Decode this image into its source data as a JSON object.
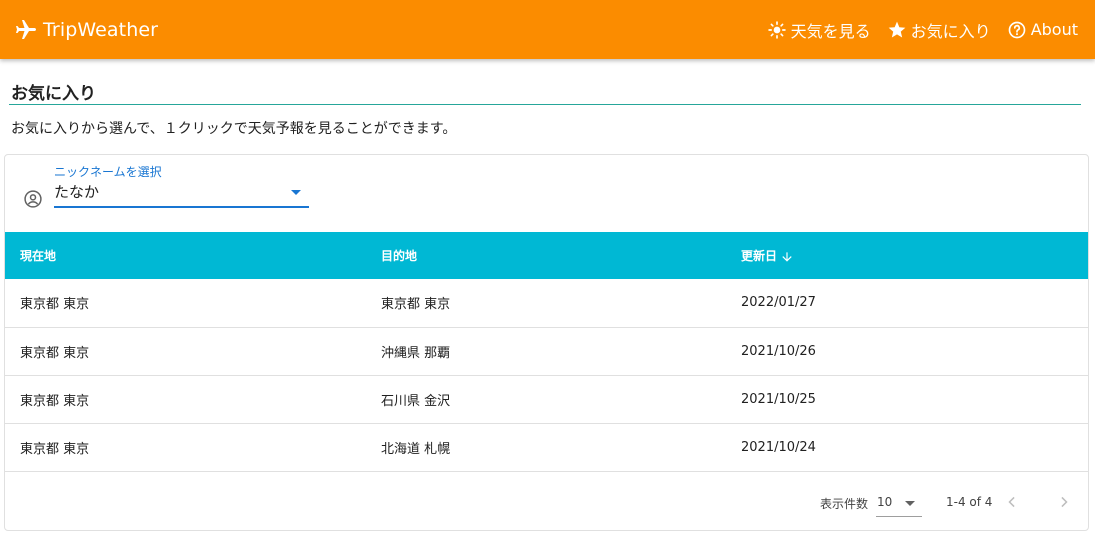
{
  "header": {
    "brand": "TripWeather",
    "nav": [
      {
        "label": "天気を見る",
        "icon": "sun-icon"
      },
      {
        "label": "お気に入り",
        "icon": "star-icon"
      },
      {
        "label": "About",
        "icon": "help-circle-icon"
      }
    ]
  },
  "page": {
    "title": "お気に入り",
    "description": "お気に入りから選んで、１クリックで天気予報を見ることができます。"
  },
  "nickname_select": {
    "label": "ニックネームを選択",
    "value": "たなか",
    "icon": "account-circle-icon"
  },
  "table": {
    "headers": [
      "現在地",
      "目的地",
      "更新日"
    ],
    "sort": {
      "column": "更新日",
      "direction": "descending",
      "icon": "arrow-down-icon"
    },
    "rows": [
      [
        "東京都 東京",
        "東京都 東京",
        "2022/01/27"
      ],
      [
        "東京都 東京",
        "沖縄県 那覇",
        "2021/10/26"
      ],
      [
        "東京都 東京",
        "石川県 金沢",
        "2021/10/25"
      ],
      [
        "東京都 東京",
        "北海道 札幌",
        "2021/10/24"
      ]
    ]
  },
  "pagination": {
    "rows_per_page_label": "表示件数",
    "rows_per_page": "10",
    "range": "1-4 of 4"
  },
  "colors": {
    "app_bar": "#fb8c00",
    "table_header": "#00b8d4",
    "accent": "#1976d2",
    "title_rule": "#26a69a"
  }
}
